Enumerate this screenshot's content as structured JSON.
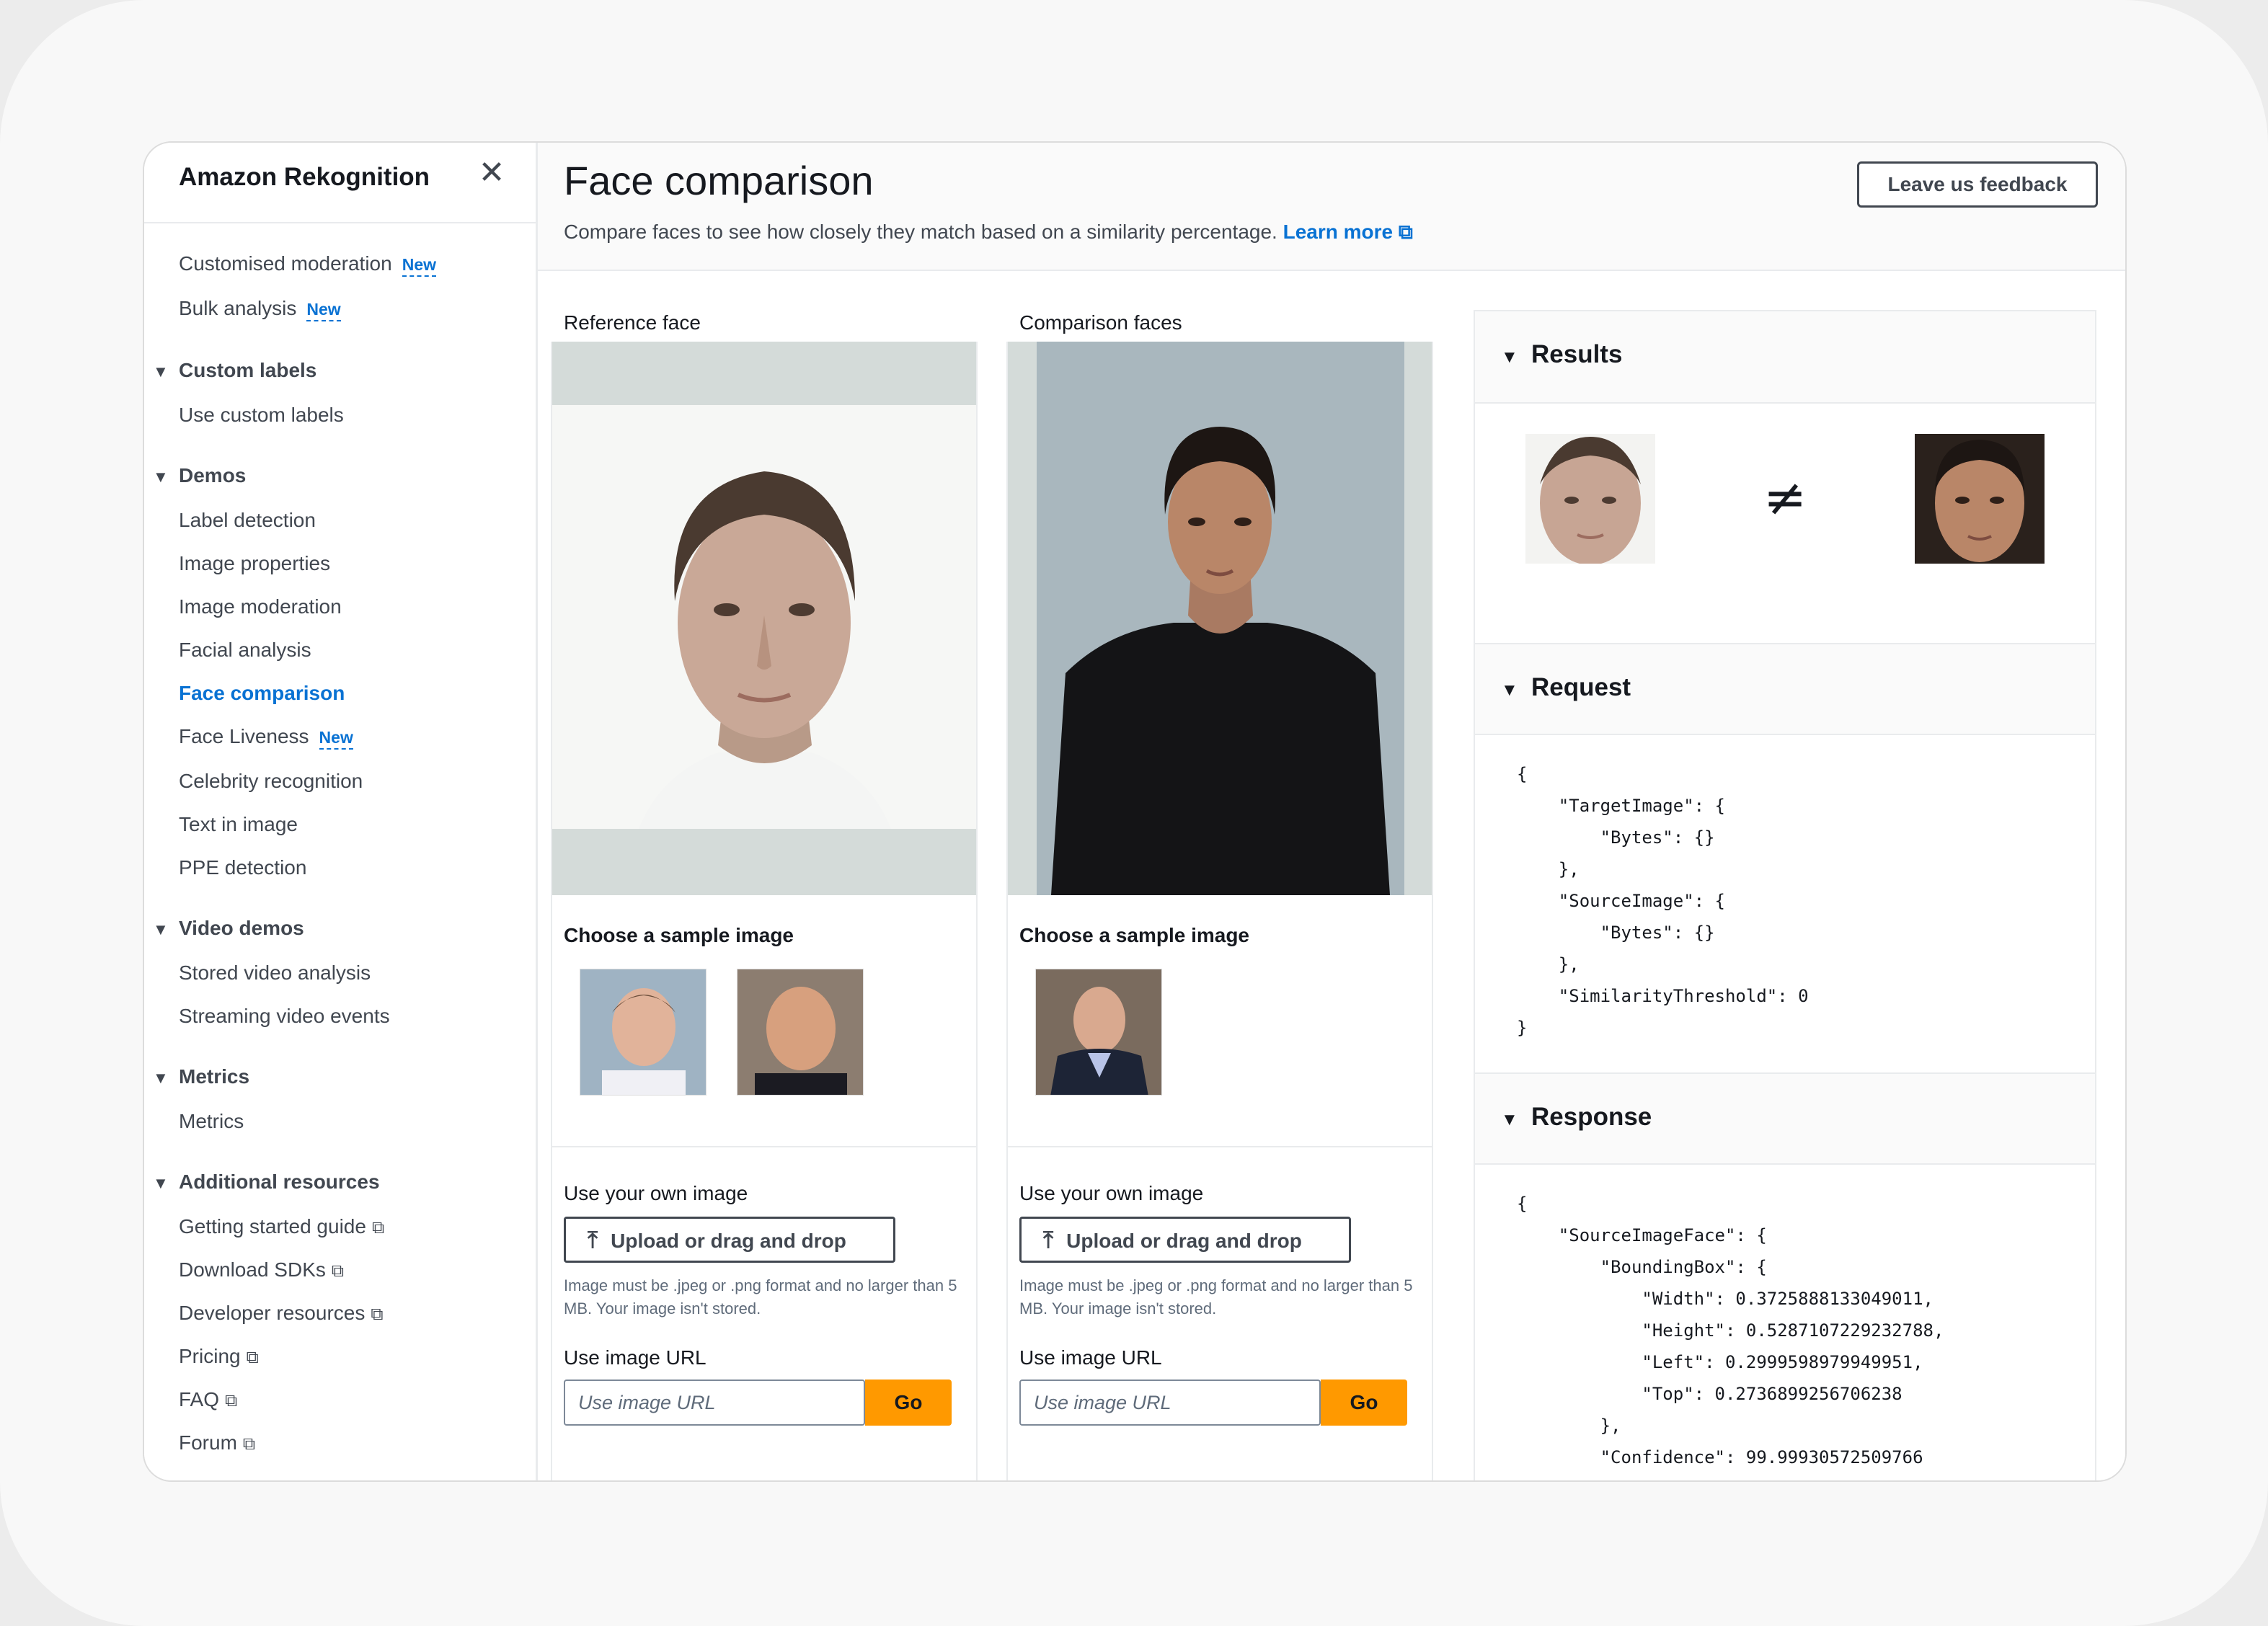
{
  "sidebar": {
    "title": "Amazon Rekognition",
    "close_icon": "close-icon",
    "items_top": [
      {
        "label": "Customised moderation",
        "badge": "New"
      },
      {
        "label": "Bulk analysis",
        "badge": "New"
      }
    ],
    "sections": [
      {
        "title": "Custom labels",
        "items": [
          "Use custom labels"
        ]
      },
      {
        "title": "Demos",
        "items": [
          "Label detection",
          "Image properties",
          "Image moderation",
          "Facial analysis",
          "Face comparison",
          "Face Liveness",
          "Celebrity recognition",
          "Text in image",
          "PPE detection"
        ]
      },
      {
        "title": "Video demos",
        "items": [
          "Stored video analysis",
          "Streaming video events"
        ]
      },
      {
        "title": "Metrics",
        "items": [
          "Metrics"
        ]
      },
      {
        "title": "Additional resources",
        "items": [
          "Getting started guide",
          "Download SDKs",
          "Developer resources",
          "Pricing",
          "FAQ",
          "Forum"
        ]
      }
    ],
    "active_item": "Face comparison",
    "liveness_badge": "New"
  },
  "header": {
    "title": "Face comparison",
    "description": "Compare faces to see how closely they match based on a similarity percentage.",
    "learn_more": "Learn more",
    "feedback_button": "Leave us feedback"
  },
  "reference": {
    "label": "Reference face",
    "sample_title": "Choose a sample image",
    "own_image": "Use your own image",
    "upload_button": "Upload or drag and drop",
    "hint": "Image must be .jpeg or .png format and no larger than 5 MB. Your image isn't stored.",
    "url_title": "Use image URL",
    "url_placeholder": "Use image URL",
    "go_button": "Go"
  },
  "comparison": {
    "label": "Comparison faces",
    "sample_title": "Choose a sample image",
    "own_image": "Use your own image",
    "upload_button": "Upload or drag and drop",
    "hint": "Image must be .jpeg or .png format and no larger than 5 MB. Your image isn't stored.",
    "url_title": "Use image URL",
    "url_placeholder": "Use image URL",
    "go_button": "Go"
  },
  "results": {
    "title": "Results",
    "symbol": "≠"
  },
  "request": {
    "title": "Request",
    "code": "{\n    \"TargetImage\": {\n        \"Bytes\": {}\n    },\n    \"SourceImage\": {\n        \"Bytes\": {}\n    },\n    \"SimilarityThreshold\": 0\n}"
  },
  "response": {
    "title": "Response",
    "code": "{\n    \"SourceImageFace\": {\n        \"BoundingBox\": {\n            \"Width\": 0.3725888133049011,\n            \"Height\": 0.5287107229232788,\n            \"Left\": 0.2999598979949951,\n            \"Top\": 0.2736899256706238\n        },\n        \"Confidence\": 99.99930572509766"
  },
  "colors": {
    "accent": "#0972d3",
    "go": "#ff9900",
    "text": "#16191f",
    "muted": "#414750"
  }
}
